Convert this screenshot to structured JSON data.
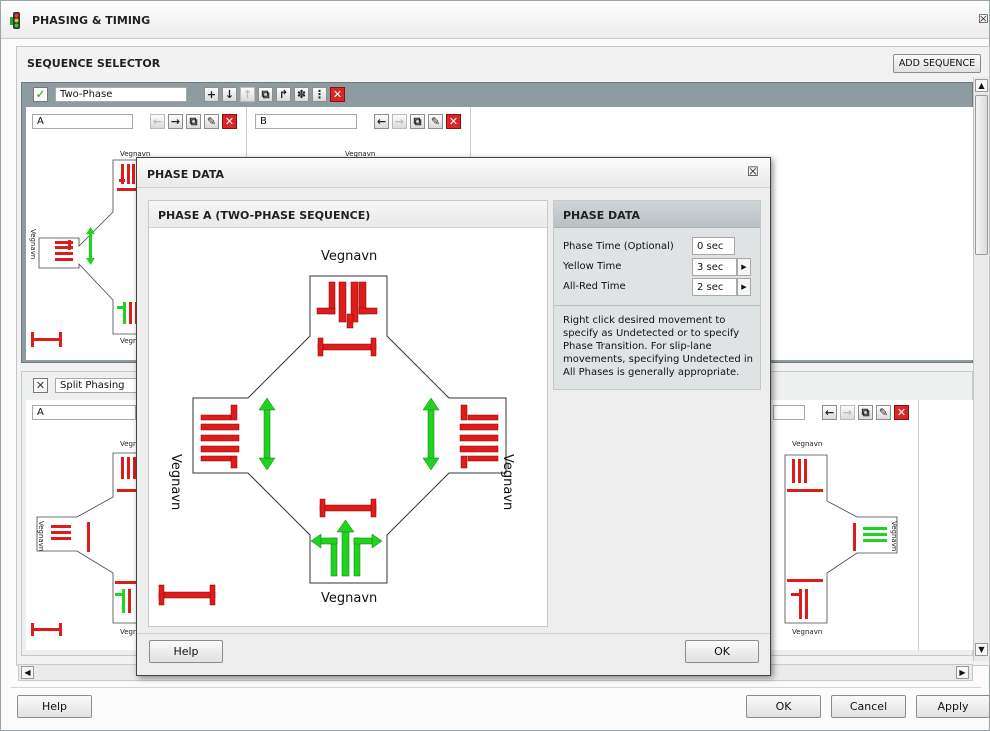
{
  "window": {
    "title": "PHASING & TIMING",
    "close": "☒"
  },
  "selector": {
    "title": "SEQUENCE SELECTOR",
    "add_btn": "ADD SEQUENCE"
  },
  "seq1": {
    "name": "Two-Phase",
    "phases": [
      {
        "label": "A"
      },
      {
        "label": "B"
      }
    ]
  },
  "seq2": {
    "name": "Split Phasing",
    "phases": [
      {
        "label": "A"
      }
    ]
  },
  "street": "Vegnavn",
  "bottom": {
    "help": "Help",
    "ok": "OK",
    "cancel": "Cancel",
    "apply": "Apply"
  },
  "dialog": {
    "title": "PHASE DATA",
    "close": "☒",
    "left_title": "PHASE A (TWO-PHASE SEQUENCE)",
    "right_title": "PHASE DATA",
    "rows": [
      {
        "label": "Phase Time (Optional)",
        "value": "0 sec"
      },
      {
        "label": "Yellow Time",
        "value": "3 sec"
      },
      {
        "label": "All-Red Time",
        "value": "2 sec"
      }
    ],
    "note": "Right click desired movement to specify as Undetected or to specify Phase Transition. For slip-lane movements, specifying Undetected in All Phases is generally appropriate.",
    "help": "Help",
    "ok": "OK"
  },
  "colors": {
    "red": "#dd1c1c",
    "green": "#21d321",
    "teal": "#7c8f93"
  }
}
